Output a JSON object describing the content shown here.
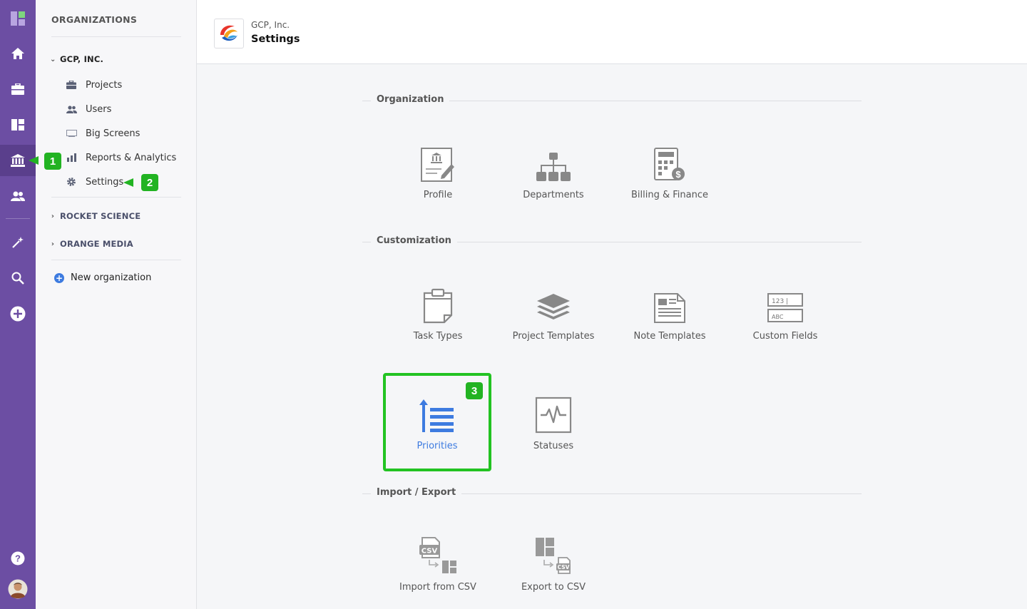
{
  "sidebar": {
    "title": "ORGANIZATIONS",
    "orgs": [
      {
        "name": "GCP, INC.",
        "expanded": true
      },
      {
        "name": "ROCKET SCIENCE",
        "expanded": false
      },
      {
        "name": "ORANGE MEDIA",
        "expanded": false
      }
    ],
    "items": [
      {
        "label": "Projects"
      },
      {
        "label": "Users"
      },
      {
        "label": "Big Screens"
      },
      {
        "label": "Reports & Analytics"
      },
      {
        "label": "Settings"
      }
    ],
    "new_org": "New organization"
  },
  "header": {
    "org": "GCP, Inc.",
    "title": "Settings"
  },
  "sections": {
    "organization": {
      "label": "Organization",
      "tiles": [
        {
          "label": "Profile",
          "icon": "profile-icon"
        },
        {
          "label": "Departments",
          "icon": "departments-icon"
        },
        {
          "label": "Billing & Finance",
          "icon": "billing-icon"
        }
      ]
    },
    "customization": {
      "label": "Customization",
      "tiles": [
        {
          "label": "Task Types",
          "icon": "task-types-icon"
        },
        {
          "label": "Project Templates",
          "icon": "project-templates-icon"
        },
        {
          "label": "Note Templates",
          "icon": "note-templates-icon"
        },
        {
          "label": "Custom Fields",
          "icon": "custom-fields-icon"
        },
        {
          "label": "Priorities",
          "icon": "priorities-icon"
        },
        {
          "label": "Statuses",
          "icon": "statuses-icon"
        }
      ]
    },
    "import_export": {
      "label": "Import / Export",
      "tiles": [
        {
          "label": "Import from CSV",
          "icon": "import-csv-icon"
        },
        {
          "label": "Export to CSV",
          "icon": "export-csv-icon"
        }
      ]
    }
  },
  "icon_text": {
    "custom_fields_num": "123 |",
    "custom_fields_abc": "ABC",
    "csv": "CSV"
  },
  "badges": [
    "1",
    "2",
    "3"
  ],
  "colors": {
    "rail": "#6c4ea3",
    "accent": "#3d7be0",
    "highlight": "#22c322"
  }
}
